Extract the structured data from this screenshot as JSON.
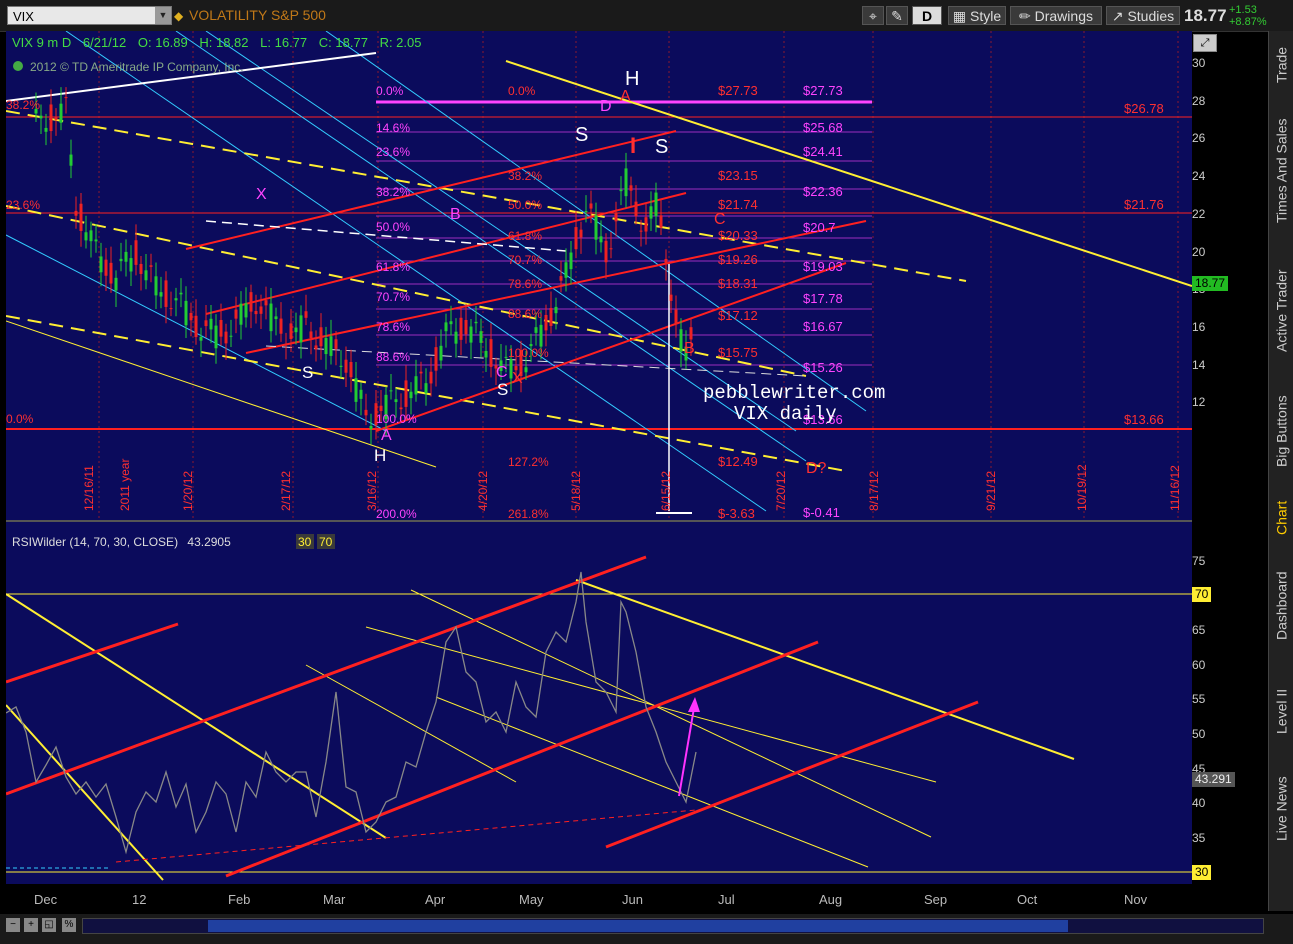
{
  "toolbar": {
    "symbol": "VIX",
    "description": "VOLATILITY S&P 500",
    "period": "D",
    "style_label": "Style",
    "drawings_label": "Drawings",
    "studies_label": "Studies",
    "last_price": "18.77",
    "change_abs": "+1.53",
    "change_pct": "+8.87%"
  },
  "main_chart": {
    "header": "VIX 9 m D",
    "date": "6/21/12",
    "ohlc": {
      "o": "O: 16.89",
      "h": "H: 18.82",
      "l": "L: 16.77",
      "c": "C: 18.77",
      "r": "R: 2.05"
    },
    "copyright": "2012 © TD Ameritrade IP Company, Inc.",
    "y_ticks": [
      "30",
      "28",
      "26",
      "24",
      "22",
      "20",
      "18",
      "16",
      "14",
      "12"
    ],
    "price_tag": "18.77",
    "watermark_line1": "pebblewriter.com",
    "watermark_line2": "VIX daily",
    "fib_left": [
      "38.2%",
      "23.6%",
      "0.0%"
    ],
    "fib_mid": [
      "0.0%",
      "14.6%",
      "23.6%",
      "38.2%",
      "50.0%",
      "61.8%",
      "70.7%",
      "78.6%",
      "88.6%",
      "100.0%",
      "200.0%"
    ],
    "fib_mid2": [
      "0.0%",
      "38.2%",
      "50.0%",
      "61.8%",
      "70.7%",
      "78.6%",
      "88.6%",
      "100.0%",
      "127.2%",
      "261.8%"
    ],
    "price_levels_red": [
      "$27.73",
      "$23.15",
      "$21.74",
      "$20.33",
      "$19.26",
      "$18.31",
      "$17.12",
      "$15.75",
      "$12.49",
      "$-3.63"
    ],
    "price_levels_mag": [
      "$27.73",
      "$25.68",
      "$24.41",
      "$22.36",
      "$20.7",
      "$19.03",
      "$17.78",
      "$16.67",
      "$15.26",
      "$13.66",
      "$-0.41"
    ],
    "right_levels": [
      "$26.78",
      "$21.76",
      "$13.66"
    ],
    "date_labels": [
      "12/16/11",
      "2011 year",
      "1/20/12",
      "2/17/12",
      "3/16/12",
      "4/20/12",
      "5/18/12",
      "6/15/12",
      "7/20/12",
      "8/17/12",
      "9/21/12",
      "10/19/12",
      "11/16/12"
    ],
    "pattern_labels": {
      "H_top": "H",
      "S1": "S",
      "S2": "S",
      "S_left": "S",
      "S_mid": "S",
      "H_bottom": "H",
      "A_top": "A",
      "D_top": "D",
      "A_bot": "A",
      "B_pur": "B",
      "C_pur": "C",
      "X_pur": "X",
      "X_red": "X",
      "C_red": "C",
      "B_red": "B",
      "D_q": "D?",
      "I_red": "I"
    }
  },
  "rsi_chart": {
    "header": "RSIWilder (14, 70, 30, CLOSE)",
    "value": "43.2905",
    "ob": "30",
    "os": "70",
    "y_ticks": [
      "75",
      "70",
      "65",
      "60",
      "55",
      "50",
      "45",
      "40",
      "35",
      "30"
    ],
    "value_tag": "43.291",
    "tag_70": "70",
    "tag_30": "30"
  },
  "x_axis": [
    "Dec",
    "12",
    "Feb",
    "Mar",
    "Apr",
    "May",
    "Jun",
    "Jul",
    "Aug",
    "Sep",
    "Oct",
    "Nov"
  ],
  "sidebar_tabs": [
    "Trade",
    "Times And Sales",
    "Active Trader",
    "Big Buttons",
    "Chart",
    "Dashboard",
    "Level II",
    "Live News"
  ],
  "colors": {
    "bg": "#0b0b5c",
    "red": "#ff2020",
    "yellow": "#ffee33",
    "cyan": "#33ccff",
    "magenta": "#ff44ff",
    "up": "#22cc33",
    "down": "#ee2222"
  }
}
